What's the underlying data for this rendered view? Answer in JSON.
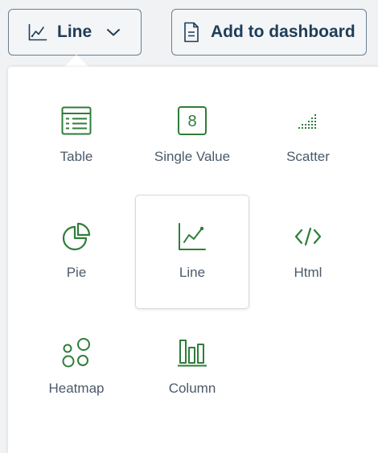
{
  "toolbar": {
    "viz_button_label": "Line",
    "viz_button_icon": "line-chart-icon",
    "add_button_label": "Add to dashboard",
    "add_button_icon": "document-icon"
  },
  "menu": {
    "selected": "Line",
    "items": [
      {
        "label": "Table",
        "icon": "table-icon"
      },
      {
        "label": "Single Value",
        "icon": "single-value-icon"
      },
      {
        "label": "Scatter",
        "icon": "scatter-icon"
      },
      {
        "label": "Pie",
        "icon": "pie-icon"
      },
      {
        "label": "Line",
        "icon": "line-chart-icon"
      },
      {
        "label": "Html",
        "icon": "html-icon"
      },
      {
        "label": "Heatmap",
        "icon": "heatmap-icon"
      },
      {
        "label": "Column",
        "icon": "column-icon"
      }
    ]
  },
  "colors": {
    "icon_green": "#2f7d3a",
    "button_text": "#1f3d58",
    "label_text": "#4a5a6a",
    "panel_bg": "#ffffff",
    "page_bg": "#f0f2f4"
  }
}
